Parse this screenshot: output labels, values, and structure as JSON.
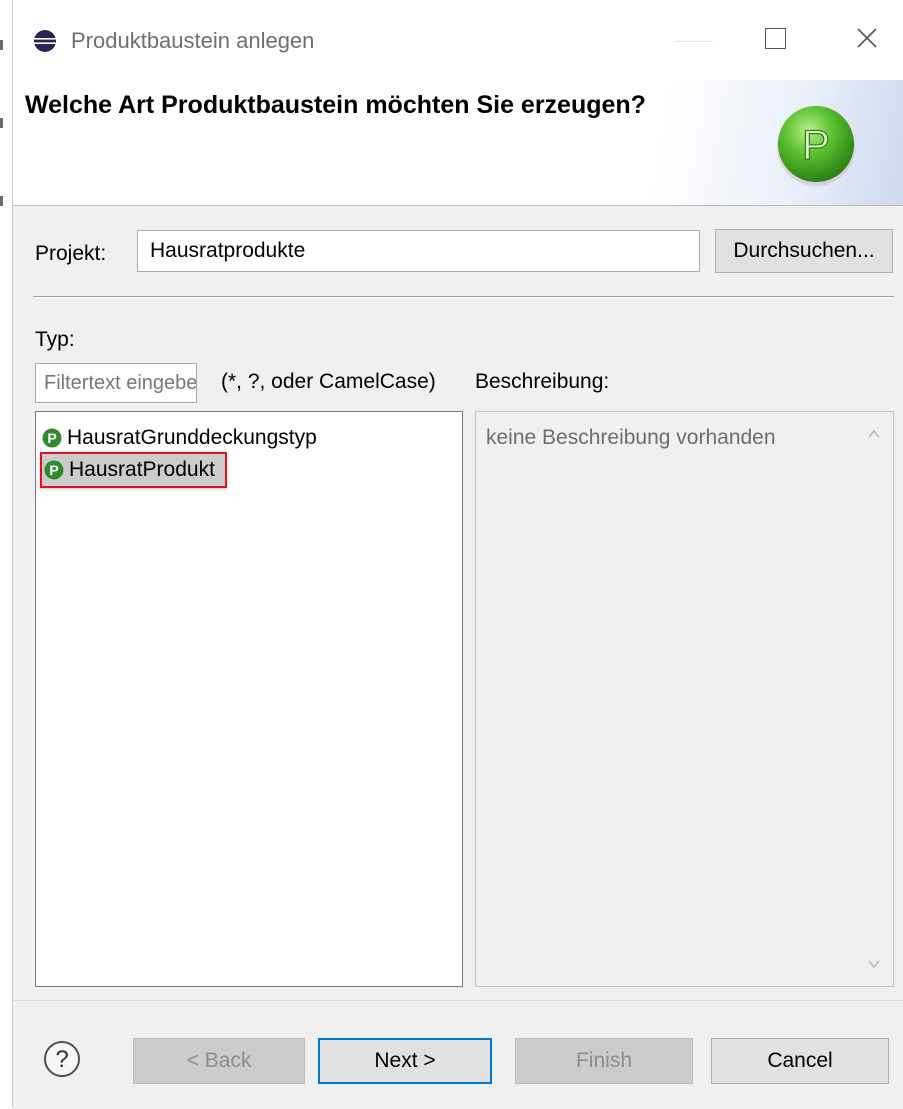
{
  "window": {
    "title": "Produktbaustein anlegen",
    "controls": [
      "maximize-icon",
      "close-icon"
    ]
  },
  "banner": {
    "heading": "Welche Art Produktbaustein möchten Sie erzeugen?",
    "logo_letter": "P"
  },
  "project": {
    "label": "Projekt:",
    "value": "Hausratprodukte",
    "browse_label": "Durchsuchen..."
  },
  "type": {
    "label": "Typ:",
    "filter_placeholder": "Filtertext eingeben",
    "filter_hint": "(*, ?, oder CamelCase)",
    "items": [
      {
        "label": "HausratGrunddeckungstyp",
        "icon": "product-p-icon",
        "selected": false
      },
      {
        "label": "HausratProdukt",
        "icon": "product-p-icon",
        "selected": true
      }
    ]
  },
  "description": {
    "label": "Beschreibung:",
    "text": "keine Beschreibung vorhanden"
  },
  "buttons": {
    "back": "< Back",
    "next": "Next >",
    "finish": "Finish",
    "cancel": "Cancel"
  },
  "colors": {
    "selection_highlight": "#e0131c",
    "icon_green": "#2e8b2e",
    "default_button_border": "#0078d7"
  }
}
